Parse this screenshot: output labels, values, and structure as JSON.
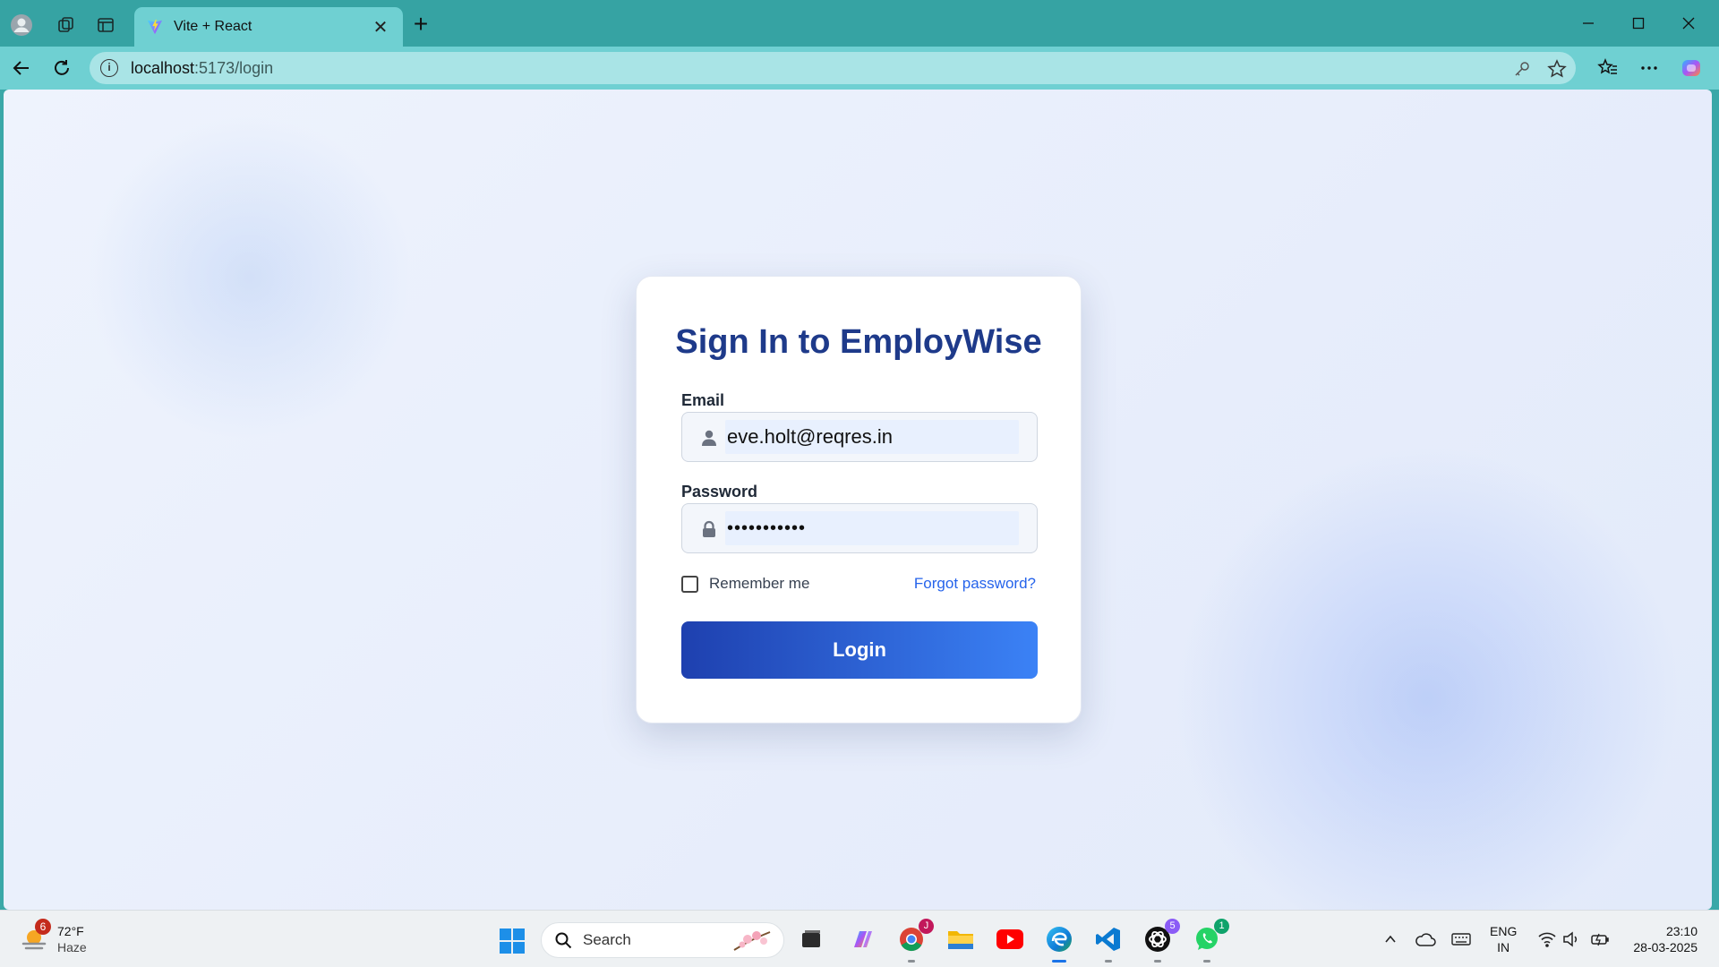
{
  "browser": {
    "tab_title": "Vite + React",
    "url_host": "localhost",
    "url_path": ":5173/login"
  },
  "login": {
    "heading": "Sign In to EmployWise",
    "email_label": "Email",
    "email_value": "eve.holt@reqres.in",
    "password_label": "Password",
    "password_value": "•••••••••••",
    "remember_label": "Remember me",
    "forgot_label": "Forgot password?",
    "login_button": "Login"
  },
  "taskbar": {
    "weather_badge": "6",
    "weather_temp": "72°F",
    "weather_condition": "Haze",
    "search_label": "Search",
    "chrome_badge": "J",
    "chatgpt_badge": "5",
    "whatsapp_badge": "1",
    "lang_line1": "ENG",
    "lang_line2": "IN",
    "time": "23:10",
    "date": "28-03-2025"
  },
  "colors": {
    "brand_heading": "#1e3a8a",
    "link": "#2563eb",
    "button_start": "#1e40af",
    "button_end": "#3b82f6",
    "browser_chrome": "#36a3a3"
  }
}
